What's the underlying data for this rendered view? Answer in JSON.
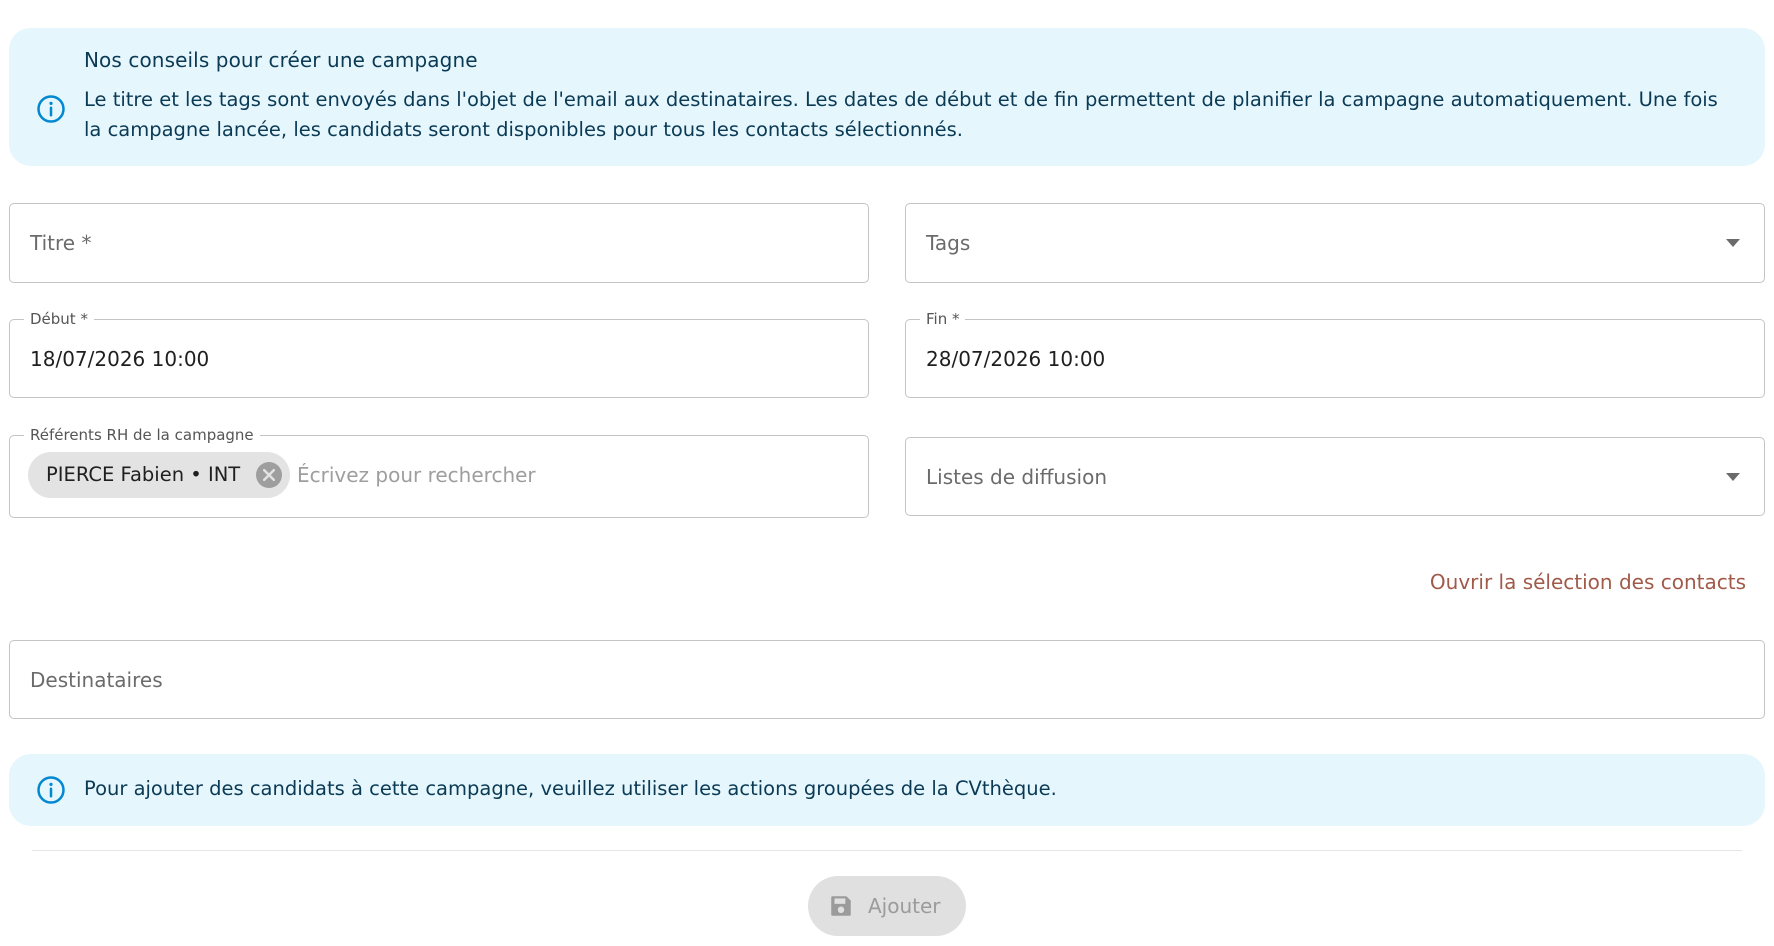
{
  "tips": {
    "title": "Nos conseils pour créer une campagne",
    "text": "Le titre et les tags sont envoyés dans l'objet de l'email aux destinataires. Les dates de début et de fin permettent de planifier la campagne automatiquement. Une fois la campagne lancée, les candidats seront disponibles pour tous les contacts sélectionnés."
  },
  "form": {
    "title_placeholder": "Titre *",
    "tags_placeholder": "Tags",
    "start_label": "Début *",
    "start_value": "18/07/2026 10:00",
    "end_label": "Fin *",
    "end_value": "28/07/2026 10:00",
    "referents_label": "Référents RH de la campagne",
    "referent_chip": "PIERCE Fabien • INT",
    "referents_search_placeholder": "Écrivez pour rechercher",
    "lists_placeholder": "Listes de diffusion",
    "open_contacts_link": "Ouvrir la sélection des contacts",
    "recipients_placeholder": "Destinataires"
  },
  "notice": {
    "text": "Pour ajouter des candidats à cette campagne, veuillez utiliser les actions groupées de la CVthèque."
  },
  "actions": {
    "submit_label": "Ajouter"
  },
  "colors": {
    "info_bg": "#e5f6fd",
    "info_icon": "#0288d1",
    "link": "#a15a4a",
    "disabled_button": "#e0e0e0"
  }
}
